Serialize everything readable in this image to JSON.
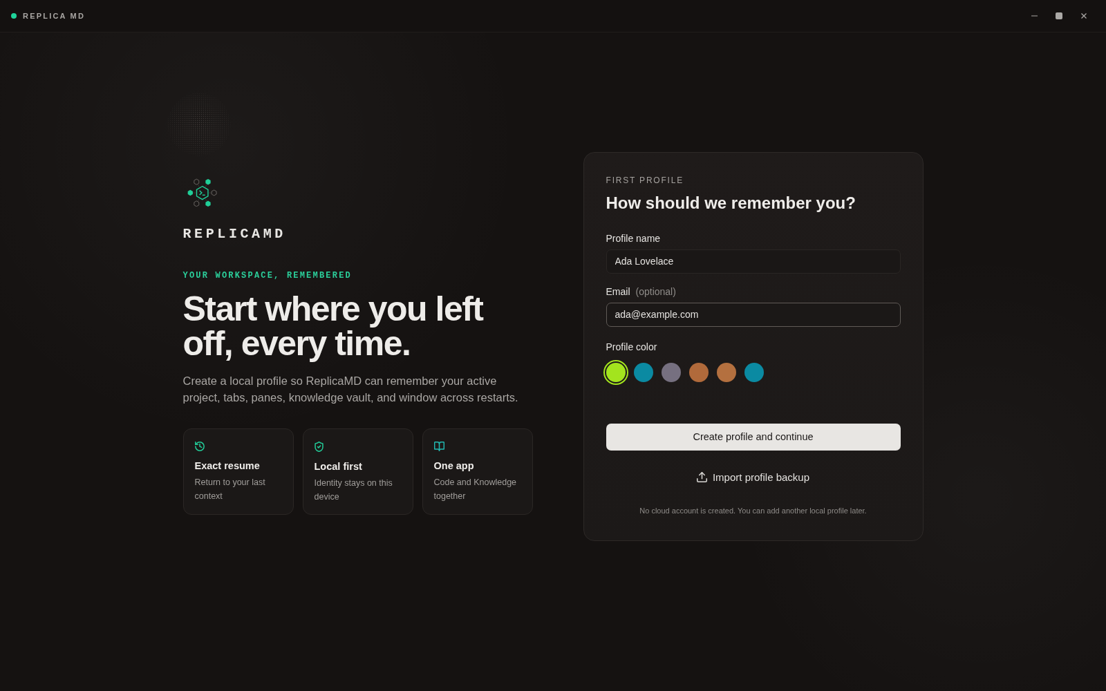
{
  "title_bar": {
    "app_name": "REPLICA MD"
  },
  "hero": {
    "wordmark": "REPLICAMD",
    "eyebrow": "YOUR WORKSPACE, REMEMBERED",
    "headline": "Start where you left off, every time.",
    "description": "Create a local profile so ReplicaMD can remember your active project, tabs, panes, knowledge vault, and window across restarts."
  },
  "features": [
    {
      "kind": "history",
      "title": "Exact resume",
      "text": "Return to your last context"
    },
    {
      "kind": "shield",
      "title": "Local first",
      "text": "Identity stays on this device"
    },
    {
      "kind": "book",
      "title": "One app",
      "text": "Code and Knowledge together"
    }
  ],
  "form": {
    "eyebrow": "FIRST PROFILE",
    "title": "How should we remember you?",
    "fields": [
      {
        "label": "Profile name",
        "value": "Ada Lovelace",
        "focused": false
      },
      {
        "label": "Email",
        "hint": "(optional)",
        "value": "ada@example.com",
        "focused": true
      }
    ],
    "color_label": "Profile color",
    "colors": [
      {
        "color": "#a3e41e",
        "selected": true
      },
      {
        "color": "#0b8aa2",
        "selected": false
      },
      {
        "color": "#767080",
        "selected": false
      },
      {
        "color": "#b16a3b",
        "selected": false
      },
      {
        "color": "#b4703f",
        "selected": false
      },
      {
        "color": "#0b8aa2",
        "selected": false
      }
    ],
    "primary_button": "Create profile and continue",
    "import_button": "Import profile backup",
    "footnote": "No cloud account is created. You can add another local profile later."
  }
}
